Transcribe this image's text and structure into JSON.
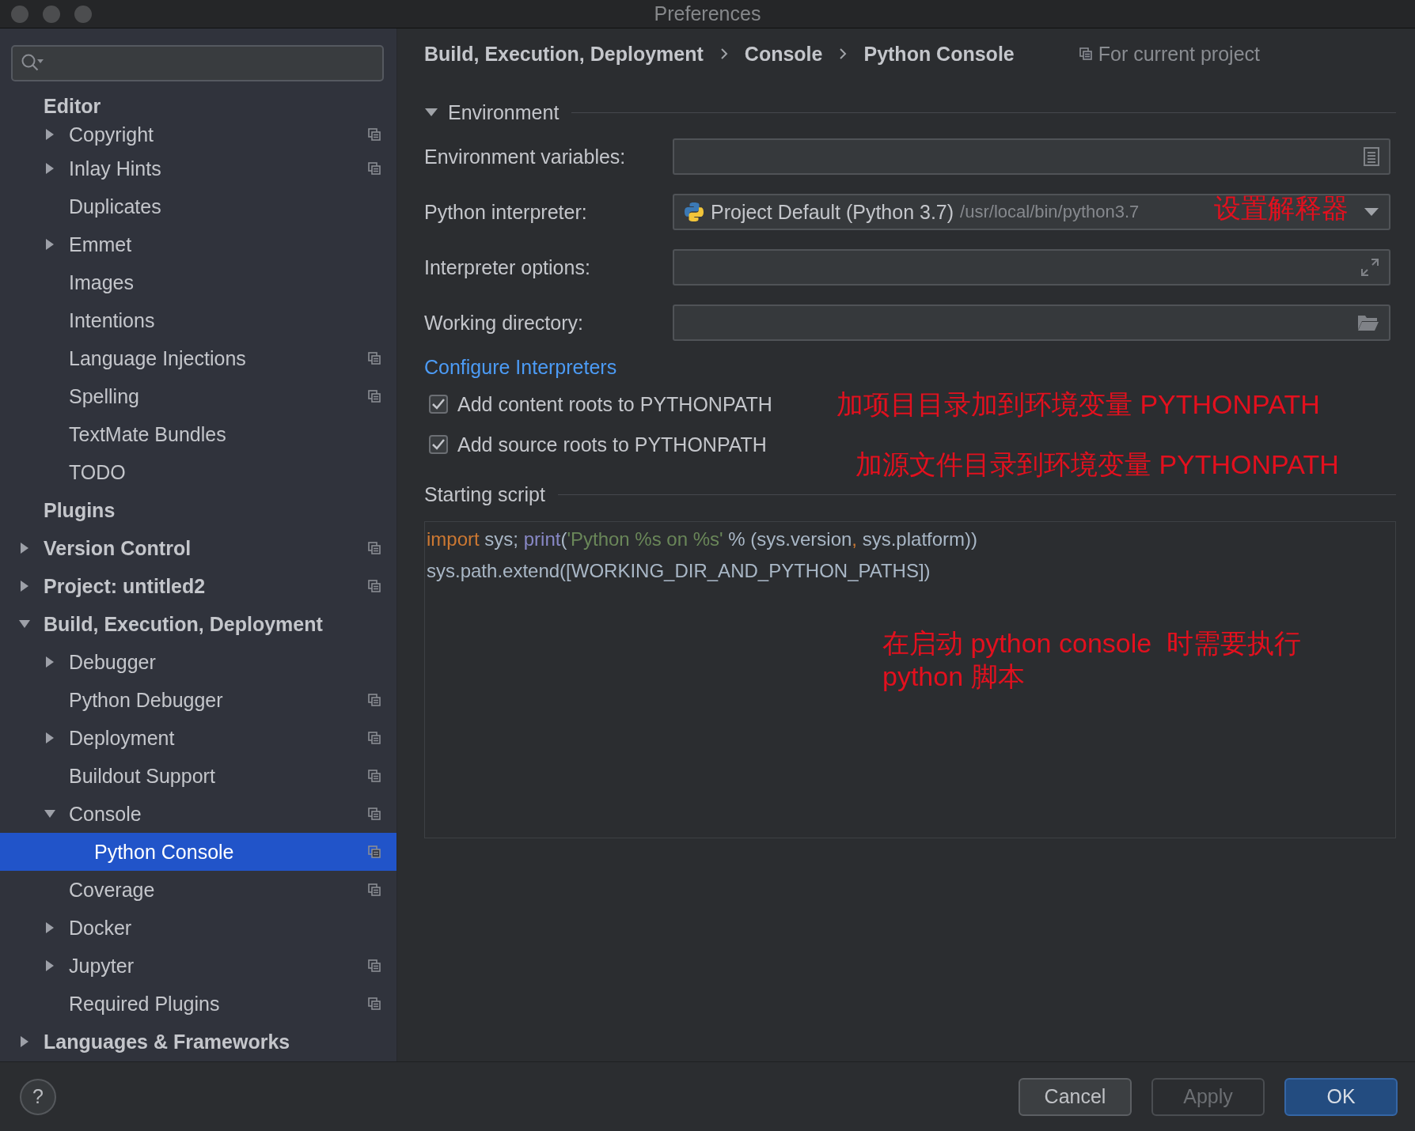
{
  "window": {
    "title": "Preferences"
  },
  "sidebar": {
    "tree": [
      {
        "label": "Editor",
        "selected": false,
        "project_scope": false,
        "children": [
          {
            "label": "Copyright",
            "expanded": false,
            "selected": false,
            "project_scope": true
          },
          {
            "label": "Inlay Hints",
            "expanded": false,
            "selected": false,
            "project_scope": true
          },
          {
            "label": "Duplicates",
            "selected": false,
            "project_scope": false
          },
          {
            "label": "Emmet",
            "expanded": false,
            "selected": false,
            "project_scope": false
          },
          {
            "label": "Images",
            "selected": false,
            "project_scope": false
          },
          {
            "label": "Intentions",
            "selected": false,
            "project_scope": false
          },
          {
            "label": "Language Injections",
            "selected": false,
            "project_scope": true
          },
          {
            "label": "Spelling",
            "selected": false,
            "project_scope": true
          },
          {
            "label": "TextMate Bundles",
            "selected": false,
            "project_scope": false
          },
          {
            "label": "TODO",
            "selected": false,
            "project_scope": false
          }
        ]
      },
      {
        "label": "Plugins",
        "selected": false,
        "project_scope": false
      },
      {
        "label": "Version Control",
        "expanded": false,
        "selected": false,
        "project_scope": true
      },
      {
        "label": "Project: untitled2",
        "expanded": false,
        "selected": false,
        "project_scope": true
      },
      {
        "label": "Build, Execution, Deployment",
        "expanded": true,
        "selected": false,
        "project_scope": false,
        "children": [
          {
            "label": "Debugger",
            "expanded": false,
            "selected": false,
            "project_scope": false
          },
          {
            "label": "Python Debugger",
            "selected": false,
            "project_scope": true
          },
          {
            "label": "Deployment",
            "expanded": false,
            "selected": false,
            "project_scope": true
          },
          {
            "label": "Buildout Support",
            "selected": false,
            "project_scope": true
          },
          {
            "label": "Console",
            "expanded": true,
            "selected": false,
            "project_scope": true,
            "children": [
              {
                "label": "Python Console",
                "selected": true,
                "project_scope": true
              }
            ]
          },
          {
            "label": "Coverage",
            "selected": false,
            "project_scope": true
          },
          {
            "label": "Docker",
            "expanded": false,
            "selected": false,
            "project_scope": false
          },
          {
            "label": "Jupyter",
            "expanded": false,
            "selected": false,
            "project_scope": true
          },
          {
            "label": "Required Plugins",
            "selected": false,
            "project_scope": true
          }
        ]
      },
      {
        "label": "Languages & Frameworks",
        "expanded": false,
        "selected": false,
        "project_scope": false
      }
    ]
  },
  "breadcrumb": [
    "Build, Execution, Deployment",
    "Console",
    "Python Console"
  ],
  "scope_label": "For current project",
  "environment": {
    "title": "Environment",
    "expanded": true,
    "fields": [
      {
        "label": "Environment variables:",
        "kind": "list"
      },
      {
        "label": "Python interpreter:",
        "kind": "interpreter",
        "value": "Project Default (Python 3.7)",
        "detail": "/usr/local/bin/python3.7"
      },
      {
        "label": "Interpreter options:",
        "kind": "expandable"
      },
      {
        "label": "Working directory:",
        "kind": "directory"
      }
    ]
  },
  "configure_link": "Configure Interpreters",
  "checkboxes": [
    {
      "label": "Add content roots to PYTHONPATH",
      "checked": true
    },
    {
      "label": "Add source roots to PYTHONPATH",
      "checked": true
    }
  ],
  "starting_script": {
    "title": "Starting script",
    "lines": [
      [
        {
          "kind": "keyword",
          "text": "import"
        },
        {
          "kind": "plain",
          "text": " sys; "
        },
        {
          "kind": "builtin",
          "text": "print"
        },
        {
          "kind": "plain",
          "text": "("
        },
        {
          "kind": "string",
          "text": "'Python %s on %s'"
        },
        {
          "kind": "plain",
          "text": " % (sys.version"
        },
        {
          "kind": "keyword",
          "text": ","
        },
        {
          "kind": "plain",
          "text": " sys.platform))"
        }
      ],
      [
        {
          "kind": "plain",
          "text": "sys.path.extend([WORKING_DIR_AND_PYTHON_PATHS])"
        }
      ]
    ]
  },
  "annotations": [
    "设置解释器",
    "加项目目录加到环境变量 PYTHONPATH",
    "加源文件目录到环境变量 PYTHONPATH",
    "在启动 python console  时需要执行\npython 脚本"
  ],
  "help": "?",
  "buttons": [
    {
      "label": "Cancel",
      "kind": "normal",
      "disabled": false
    },
    {
      "label": "Apply",
      "kind": "normal",
      "disabled": true
    },
    {
      "label": "OK",
      "kind": "default",
      "disabled": false
    }
  ]
}
